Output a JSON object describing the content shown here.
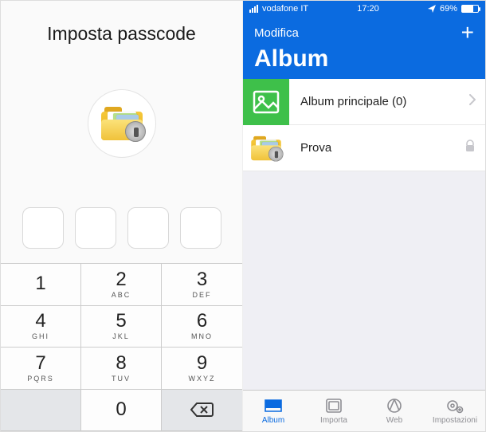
{
  "passcode": {
    "title": "Imposta passcode",
    "keys": [
      {
        "num": "1",
        "sub": ""
      },
      {
        "num": "2",
        "sub": "ABC"
      },
      {
        "num": "3",
        "sub": "DEF"
      },
      {
        "num": "4",
        "sub": "GHI"
      },
      {
        "num": "5",
        "sub": "JKL"
      },
      {
        "num": "6",
        "sub": "MNO"
      },
      {
        "num": "7",
        "sub": "PQRS"
      },
      {
        "num": "8",
        "sub": "TUV"
      },
      {
        "num": "9",
        "sub": "WXYZ"
      }
    ],
    "zero": "0"
  },
  "statusbar": {
    "carrier": "vodafone IT",
    "time": "17:20",
    "battery_pct": "69%"
  },
  "header": {
    "edit": "Modifica",
    "title": "Album"
  },
  "albums": [
    {
      "label": "Album principale (0)"
    },
    {
      "label": "Prova"
    }
  ],
  "tabs": {
    "album": "Album",
    "importa": "Importa",
    "web": "Web",
    "impostazioni": "Impostazioni"
  }
}
